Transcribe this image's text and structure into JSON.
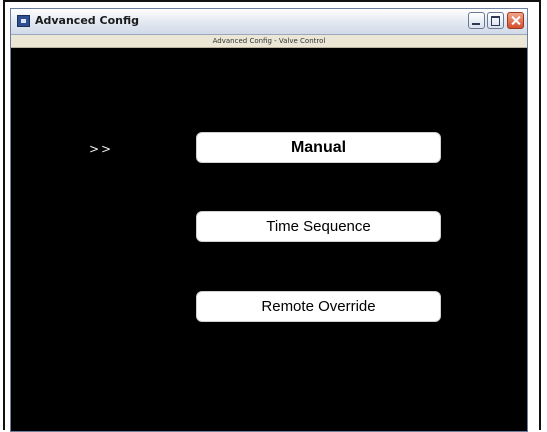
{
  "window": {
    "title": "Advanced Config",
    "icon": "app-window-icon",
    "controls": [
      "minimize-icon",
      "maximize-icon",
      "close-icon"
    ]
  },
  "header": {
    "subtitle": "Advanced Config - Valve Control"
  },
  "menu": {
    "indicator": ">>",
    "items": [
      {
        "label": "Manual",
        "selected": true
      },
      {
        "label": "Time Sequence",
        "selected": false
      },
      {
        "label": "Remote Override",
        "selected": false
      }
    ]
  },
  "colors": {
    "background": "#000000",
    "button": "#ffffff",
    "subtitle_bar": "#ece6d6",
    "close_button": "#d2502e"
  }
}
